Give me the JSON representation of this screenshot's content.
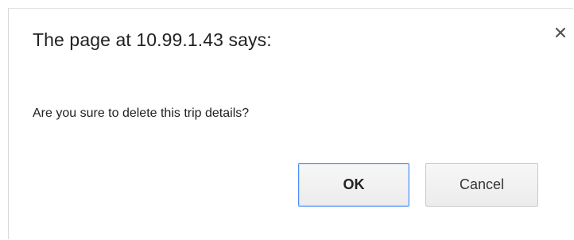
{
  "dialog": {
    "title": "The page at 10.99.1.43 says:",
    "message": "Are you sure to delete this trip details?",
    "ok_label": "OK",
    "cancel_label": "Cancel",
    "close_icon": "close-icon",
    "accent_color": "#4d90fe"
  }
}
